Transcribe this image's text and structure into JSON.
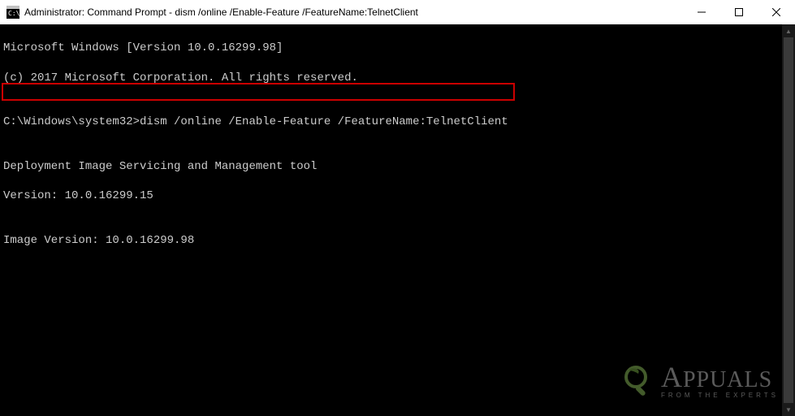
{
  "titlebar": {
    "title": "Administrator: Command Prompt - dism  /online /Enable-Feature /FeatureName:TelnetClient"
  },
  "console": {
    "line1": "Microsoft Windows [Version 10.0.16299.98]",
    "line2": "(c) 2017 Microsoft Corporation. All rights reserved.",
    "blank1": "",
    "prompt_line": "C:\\Windows\\system32>dism /online /Enable-Feature /FeatureName:TelnetClient",
    "blank2": "",
    "tool_line": "Deployment Image Servicing and Management tool",
    "version_line": "Version: 10.0.16299.15",
    "blank3": "",
    "image_version_line": "Image Version: 10.0.16299.98",
    "blank4": ""
  },
  "watermark": {
    "brand": "PPUALS",
    "brand_prefix_big": "A",
    "subtitle": "FROM THE EXPERTS"
  }
}
